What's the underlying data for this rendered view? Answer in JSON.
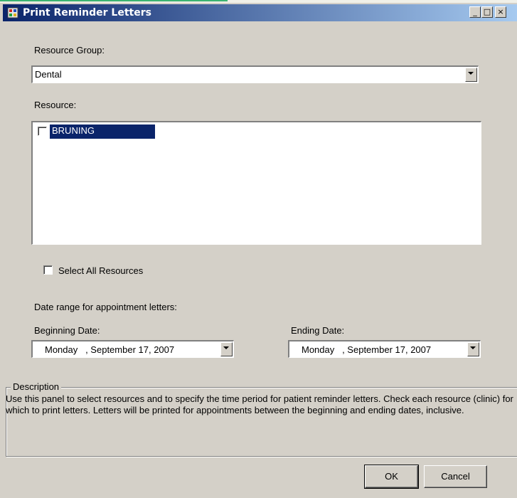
{
  "window": {
    "title": "Print Reminder Letters",
    "controls": {
      "minimize": "_",
      "maximize": "□",
      "close": "×"
    }
  },
  "resource_group": {
    "label": "Resource Group:",
    "selected": "Dental"
  },
  "resource": {
    "label": "Resource:",
    "items": [
      {
        "label": "BRUNING",
        "checked": false,
        "selected": true
      }
    ]
  },
  "select_all": {
    "label": "Select All Resources",
    "checked": false
  },
  "date_range": {
    "label": "Date range for appointment letters:",
    "beginning": {
      "label": "Beginning Date:",
      "value": "Monday   , September 17, 2007"
    },
    "ending": {
      "label": "Ending  Date:",
      "value": "Monday   , September 17, 2007"
    }
  },
  "description": {
    "legend": "Description",
    "text": "Use this panel to select resources and to specify the time period for patient reminder letters.  Check each resource (clinic) for which to print letters.  Letters will be printed for appointments between the beginning and ending dates, inclusive."
  },
  "buttons": {
    "ok": "OK",
    "cancel": "Cancel"
  },
  "colors": {
    "titlebar": "#0a246a",
    "face": "#d4d0c8",
    "selection": "#0a246a"
  }
}
